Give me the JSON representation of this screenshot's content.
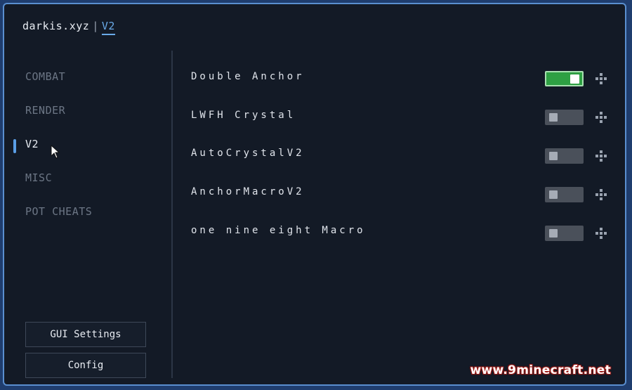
{
  "header": {
    "brand": "darkis.xyz",
    "separator": "|",
    "version": "V2"
  },
  "sidebar": {
    "categories": [
      {
        "label": "COMBAT",
        "active": false
      },
      {
        "label": "RENDER",
        "active": false
      },
      {
        "label": "V2",
        "active": true
      },
      {
        "label": "MISC",
        "active": false
      },
      {
        "label": "POT CHEATS",
        "active": false
      }
    ],
    "buttons": {
      "gui_settings": "GUI Settings",
      "config": "Config"
    }
  },
  "modules": [
    {
      "name": "Double Anchor",
      "enabled": true
    },
    {
      "name": "LWFH Crystal",
      "enabled": false
    },
    {
      "name": "AutoCrystalV2",
      "enabled": false
    },
    {
      "name": "AnchorMacroV2",
      "enabled": false
    },
    {
      "name": "one nine eight Macro",
      "enabled": false
    }
  ],
  "icons": {
    "toggle_handle": "move-icon",
    "cursor": "mouse-pointer-icon"
  },
  "colors": {
    "accent": "#5a9ee6",
    "toggle_on": "#2ea043",
    "toggle_off": "#4a505a",
    "background": "#131a26"
  },
  "watermark": "www.9minecraft.net"
}
